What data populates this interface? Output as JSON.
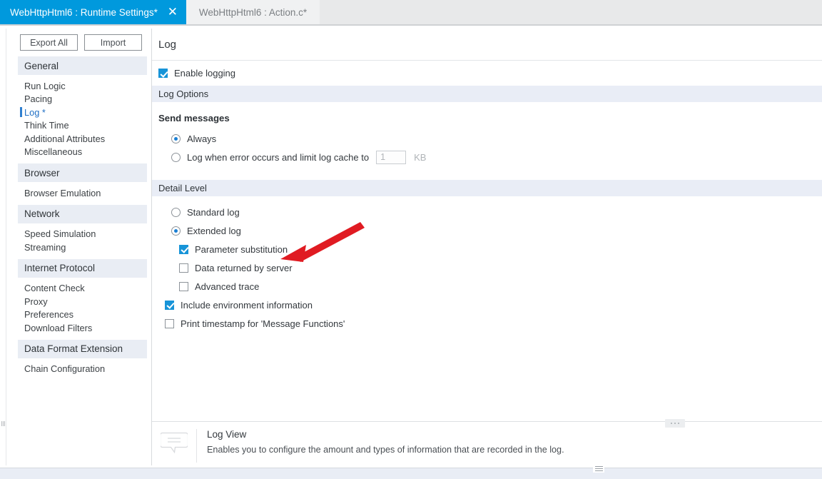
{
  "tabs": [
    {
      "label": "WebHttpHtml6 : Runtime Settings*",
      "active": true,
      "close_icon": "✕"
    },
    {
      "label": "WebHttpHtml6 : Action.c*",
      "active": false
    }
  ],
  "sidebar": {
    "buttons": [
      {
        "label": "Export All"
      },
      {
        "label": "Import"
      }
    ],
    "groups": [
      {
        "header": "General",
        "items": [
          {
            "label": "Run Logic",
            "selected": false
          },
          {
            "label": "Pacing",
            "selected": false
          },
          {
            "label": "Log *",
            "selected": true
          },
          {
            "label": "Think Time",
            "selected": false
          },
          {
            "label": "Additional Attributes",
            "selected": false
          },
          {
            "label": "Miscellaneous",
            "selected": false
          }
        ]
      },
      {
        "header": "Browser",
        "items": [
          {
            "label": "Browser Emulation",
            "selected": false
          }
        ]
      },
      {
        "header": "Network",
        "items": [
          {
            "label": "Speed Simulation",
            "selected": false
          },
          {
            "label": "Streaming",
            "selected": false
          }
        ]
      },
      {
        "header": "Internet Protocol",
        "items": [
          {
            "label": "Content Check",
            "selected": false
          },
          {
            "label": "Proxy",
            "selected": false
          },
          {
            "label": "Preferences",
            "selected": false
          },
          {
            "label": "Download Filters",
            "selected": false
          }
        ]
      },
      {
        "header": "Data Format Extension",
        "items": [
          {
            "label": "Chain Configuration",
            "selected": false
          }
        ]
      }
    ]
  },
  "main": {
    "title": "Log",
    "enable_logging": {
      "label": "Enable logging",
      "checked": true
    },
    "log_options": {
      "header": "Log Options",
      "group_label": "Send messages",
      "radios": [
        {
          "label": "Always",
          "selected": true
        },
        {
          "label": "Log when error occurs and limit log cache to",
          "selected": false
        }
      ],
      "cache_value": "1",
      "cache_unit": "KB"
    },
    "detail_level": {
      "header": "Detail Level",
      "radios": [
        {
          "label": "Standard log",
          "selected": false
        },
        {
          "label": "Extended log",
          "selected": true
        }
      ],
      "sub_checkboxes": [
        {
          "label": "Parameter substitution",
          "checked": true
        },
        {
          "label": "Data returned by server",
          "checked": false
        },
        {
          "label": "Advanced trace",
          "checked": false
        }
      ],
      "checkboxes": [
        {
          "label": "Include environment information",
          "checked": true
        },
        {
          "label": "Print timestamp for 'Message Functions'",
          "checked": false
        }
      ]
    }
  },
  "info_panel": {
    "title": "Log View",
    "description": "Enables you to configure the amount and types of information that are recorded in the log."
  },
  "annotation": {
    "type": "arrow",
    "color": "#e01b22",
    "points_to": "Parameter substitution"
  },
  "colors": {
    "accent": "#0099dd",
    "checkbox_fill": "#1794d8",
    "selected_item": "#1f6fc4",
    "section_band": "#e9edf6",
    "arrow_red": "#e01b22"
  }
}
